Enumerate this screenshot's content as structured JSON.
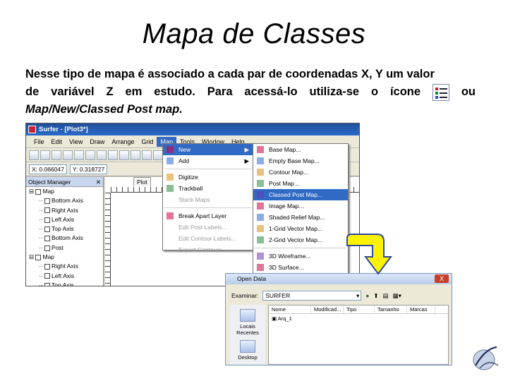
{
  "slide": {
    "title": "Mapa de Classes",
    "paragraph": {
      "line1": "Nesse tipo de mapa é associado a cada par de coordenadas X, Y um valor",
      "line2_words": [
        "de",
        "variável",
        "Z",
        "em",
        "estudo.",
        "Para",
        "acessá-lo",
        "utiliza-se",
        "o",
        "ícone"
      ],
      "line2_end": "ou",
      "line3": "Map/New/Classed Post map."
    }
  },
  "surfer": {
    "title": "Surfer - [Plot3*]",
    "menu": [
      "File",
      "Edit",
      "View",
      "Draw",
      "Arrange",
      "Grid",
      "Map",
      "Tools",
      "Window",
      "Help"
    ],
    "coords": {
      "x": "X: 0.066047",
      "y": "Y: 0.318727"
    },
    "object_manager": {
      "title": "Object Manager",
      "items": [
        "Map",
        "Bottom Axis",
        "Right Axis",
        "Left Axis",
        "Top Axis",
        "Bottom Axis",
        "Post",
        "Map",
        "Right Axis",
        "Left Axis",
        "Top Axis"
      ]
    },
    "plot_tab": "Plot",
    "map_menu": [
      {
        "label": "New",
        "arrow": "▶",
        "highlight": true
      },
      {
        "label": "Add",
        "arrow": "▶"
      },
      {
        "label": "Digitize"
      },
      {
        "label": "Trackball"
      },
      {
        "label": "Stack Maps",
        "disabled": true
      },
      {
        "label": "Break Apart Layer"
      },
      {
        "label": "Edit Post Labels...",
        "disabled": true
      },
      {
        "label": "Edit Contour Labels...",
        "disabled": true
      },
      {
        "label": "Export Contours...",
        "disabled": true
      }
    ],
    "new_submenu": [
      {
        "label": "Base Map..."
      },
      {
        "label": "Empty Base Map..."
      },
      {
        "label": "Contour Map..."
      },
      {
        "label": "Post Map..."
      },
      {
        "label": "Classed Post Map...",
        "highlight": true
      },
      {
        "label": "Image Map..."
      },
      {
        "label": "Shaded Relief Map..."
      },
      {
        "label": "1-Grid Vector Map..."
      },
      {
        "label": "2-Grid Vector Map..."
      },
      {
        "label": "3D Wireframe..."
      },
      {
        "label": "3D Surface..."
      }
    ]
  },
  "dialog": {
    "title": "Open Data",
    "close": "X",
    "look_in_label": "Examinar:",
    "folder": "SURFER",
    "places": [
      "Locais Recentes",
      "Desktop"
    ],
    "columns": [
      "Nome",
      "Modificad...",
      "Tipo",
      "Tamanho",
      "Marcas"
    ],
    "files": [
      "Arq_1"
    ]
  },
  "colors": {
    "highlight": "#316ac5",
    "arrow_fill": "#fff200",
    "arrow_stroke": "#2a4aa0"
  }
}
